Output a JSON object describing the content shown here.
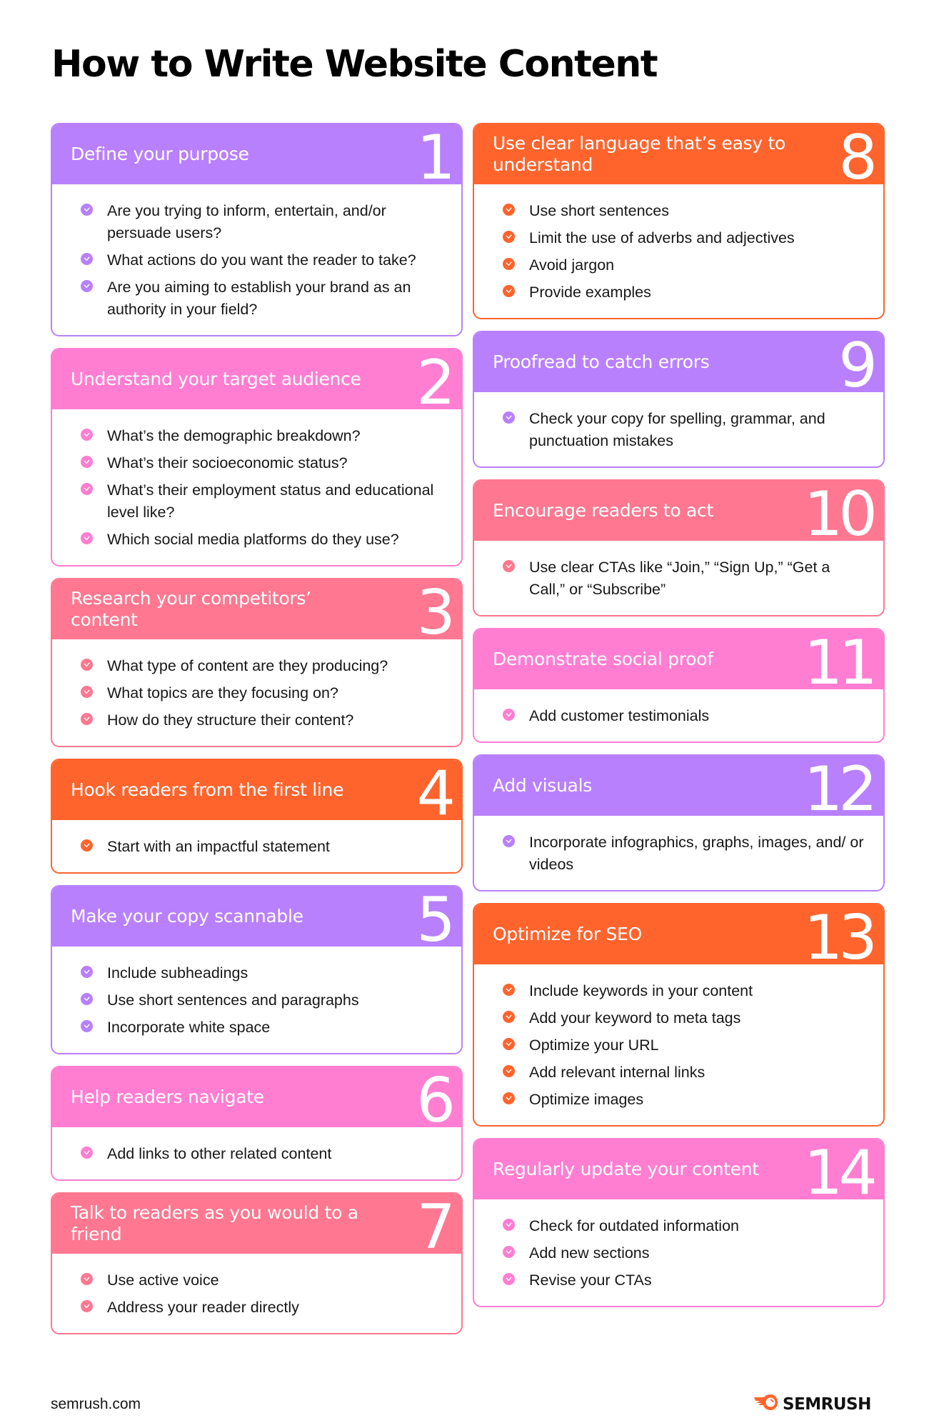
{
  "title": "How to Write Website Content",
  "colors": {
    "purple": "#b980fd",
    "pink": "#ff7ed2",
    "coral": "#ff7790",
    "orange": "#ff642d"
  },
  "left_column": [
    {
      "number": "1",
      "color": "purple",
      "heading": "Define your purpose",
      "items": [
        "Are you trying to inform, entertain, and/or persuade users?",
        "What actions do you want the reader to take?",
        "Are you aiming to establish your brand as an authority in your field?"
      ]
    },
    {
      "number": "2",
      "color": "pink",
      "heading": "Understand your target audience",
      "items": [
        "What’s the demographic breakdown?",
        "What’s their socioeconomic status?",
        "What’s their employment status and educational level like?",
        "Which social media platforms do they use?"
      ]
    },
    {
      "number": "3",
      "color": "coral",
      "heading": "Research your competitors’ content",
      "items": [
        "What type of content are they producing?",
        "What topics are they focusing on?",
        "How do they structure their content?"
      ]
    },
    {
      "number": "4",
      "color": "orange",
      "heading": "Hook readers from the first line",
      "items": [
        "Start with an impactful statement"
      ]
    },
    {
      "number": "5",
      "color": "purple",
      "heading": "Make your copy scannable",
      "items": [
        "Include subheadings",
        "Use short sentences and paragraphs",
        "Incorporate white space"
      ]
    },
    {
      "number": "6",
      "color": "pink",
      "heading": "Help readers navigate",
      "items": [
        "Add links to other related content"
      ]
    },
    {
      "number": "7",
      "color": "coral",
      "heading": "Talk to readers as you would to a friend",
      "items": [
        "Use active voice",
        "Address your reader directly"
      ]
    }
  ],
  "right_column": [
    {
      "number": "8",
      "color": "orange",
      "heading": "Use clear language that’s easy to understand",
      "items": [
        "Use short sentences",
        "Limit the use of adverbs and adjectives",
        "Avoid jargon",
        "Provide examples"
      ]
    },
    {
      "number": "9",
      "color": "purple",
      "heading": "Proofread to catch errors",
      "items": [
        "Check your copy for spelling, grammar, and punctuation mistakes"
      ]
    },
    {
      "number": "10",
      "color": "coral",
      "heading": "Encourage readers to act",
      "items": [
        "Use clear CTAs like “Join,” “Sign Up,” “Get a Call,” or “Subscribe”"
      ]
    },
    {
      "number": "11",
      "color": "pink",
      "heading": "Demonstrate social proof",
      "items": [
        "Add customer testimonials"
      ]
    },
    {
      "number": "12",
      "color": "purple",
      "heading": "Add visuals",
      "items": [
        "Incorporate infographics, graphs, images, and/ or videos"
      ]
    },
    {
      "number": "13",
      "color": "orange",
      "heading": "Optimize for SEO",
      "items": [
        "Include keywords in your content",
        "Add your keyword to meta tags",
        "Optimize your URL",
        "Add relevant internal links",
        "Optimize images"
      ]
    },
    {
      "number": "14",
      "color": "pink",
      "heading": "Regularly update your content",
      "items": [
        "Check for outdated information",
        "Add new sections",
        "Revise your CTAs"
      ]
    }
  ],
  "footer": {
    "url": "semrush.com",
    "brand": "SEMRUSH",
    "brand_icon": "semrush-fireball-icon",
    "brand_color": "#ff642d"
  }
}
